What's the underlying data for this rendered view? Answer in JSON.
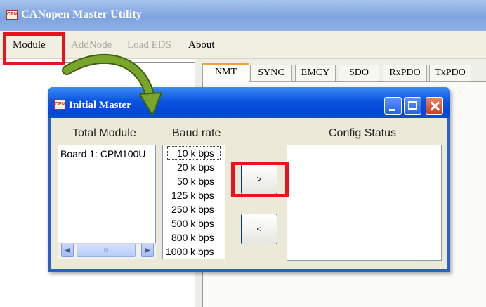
{
  "main_window": {
    "icon_text": "CPM",
    "title": "CANopen Master Utility",
    "menu": {
      "module": "Module",
      "add_node": "AddNode",
      "load_eds": "Load EDS",
      "about": "About"
    },
    "tabs": [
      "NMT",
      "SYNC",
      "EMCY",
      "SDO",
      "RxPDO",
      "TxPDO"
    ]
  },
  "dialog": {
    "icon_text": "CPM",
    "title": "Initial Master",
    "total_module_label": "Total Module",
    "modules": [
      "Board 1: CPM100U"
    ],
    "baud_rate_label": "Baud rate",
    "baud_rates": [
      "10 k bps",
      "20 k bps",
      "50 k bps",
      "125 k bps",
      "250 k bps",
      "500 k bps",
      "800 k bps",
      "1000 k bps"
    ],
    "selected_baud_rate": "10 k bps",
    "config_status_label": "Config Status",
    "config_status_items": [],
    "add_button": ">",
    "remove_button": "<",
    "scroll_thumb_grip": "III",
    "scroll_left": "◀",
    "scroll_right": "▶"
  },
  "annotations": {
    "highlight_color": "#e8141c",
    "arrow_color": "#6e9a24"
  }
}
